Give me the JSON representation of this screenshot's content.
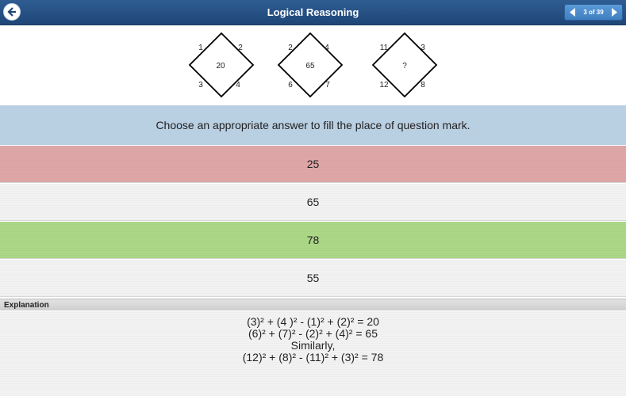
{
  "header": {
    "title": "Logical Reasoning",
    "pager": "3 of 39",
    "icons": [
      "back-arrow-icon",
      "prev-arrow-icon",
      "next-arrow-icon"
    ]
  },
  "puzzle": {
    "figures": [
      {
        "top_left": "1",
        "top_right": "2",
        "center": "20",
        "bottom_left": "3",
        "bottom_right": "4"
      },
      {
        "top_left": "2",
        "top_right": "4",
        "center": "65",
        "bottom_left": "6",
        "bottom_right": "7"
      },
      {
        "top_left": "11",
        "top_right": "3",
        "center": "?",
        "bottom_left": "12",
        "bottom_right": "8"
      }
    ]
  },
  "question": "Choose an appropriate answer to fill the place of question mark.",
  "options": [
    "25",
    "65",
    "78",
    "55"
  ],
  "explanation": {
    "label": "Explanation",
    "lines": [
      "(3)² + (4 )² - (1)² + (2)² = 20",
      "(6)² + (7)² - (2)² + (4)² = 65",
      "Similarly,",
      "(12)² + (8)² - (11)² + (3)² = 78"
    ]
  },
  "colors": {
    "header": "#2f5d92",
    "question_bg": "#b9cfe2",
    "wrong_answer": "#dfa6a7",
    "correct_answer": "#abd786"
  }
}
